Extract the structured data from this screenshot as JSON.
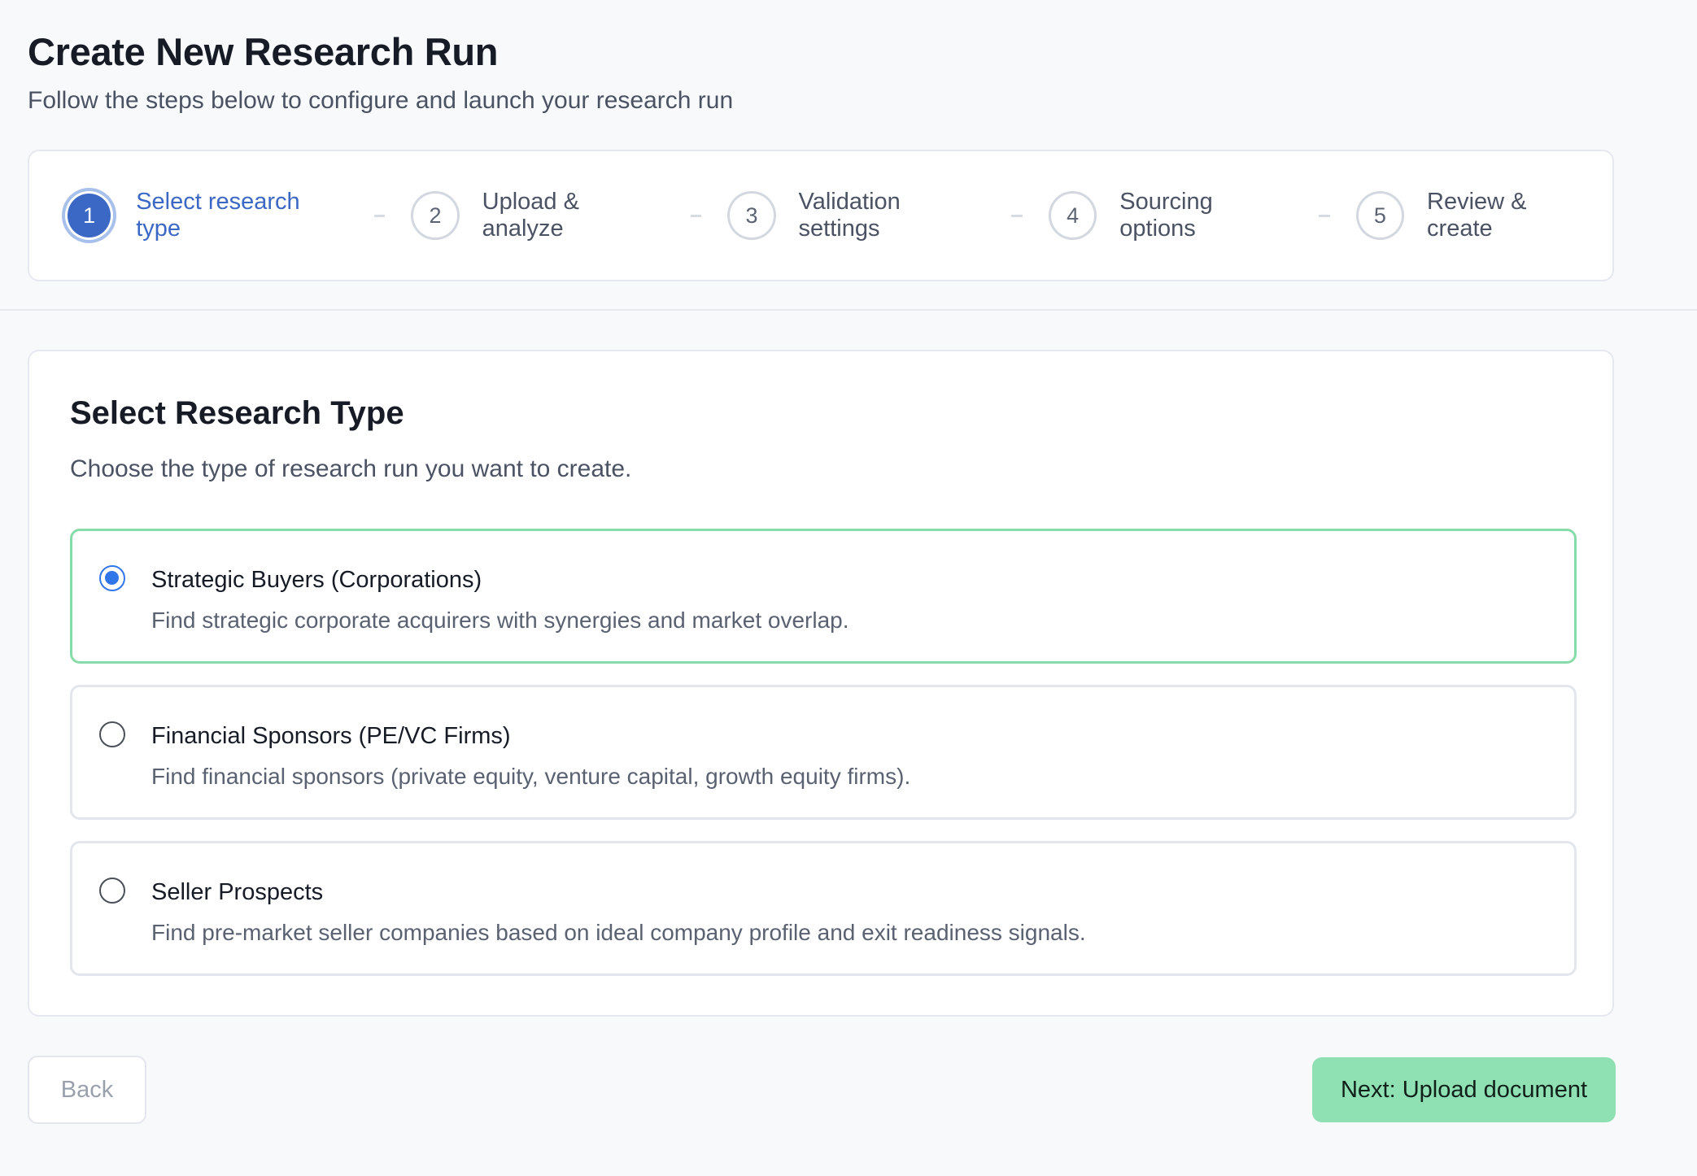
{
  "header": {
    "title": "Create New Research Run",
    "subtitle": "Follow the steps below to configure and launch your research run"
  },
  "stepper": {
    "steps": [
      {
        "number": "1",
        "label": "Select research type",
        "active": true
      },
      {
        "number": "2",
        "label": "Upload & analyze",
        "active": false
      },
      {
        "number": "3",
        "label": "Validation settings",
        "active": false
      },
      {
        "number": "4",
        "label": "Sourcing options",
        "active": false
      },
      {
        "number": "5",
        "label": "Review & create",
        "active": false
      }
    ]
  },
  "card": {
    "title": "Select Research Type",
    "subtitle": "Choose the type of research run you want to create."
  },
  "options": [
    {
      "title": "Strategic Buyers (Corporations)",
      "description": "Find strategic corporate acquirers with synergies and market overlap.",
      "selected": true
    },
    {
      "title": "Financial Sponsors (PE/VC Firms)",
      "description": "Find financial sponsors (private equity, venture capital, growth equity firms).",
      "selected": false
    },
    {
      "title": "Seller Prospects",
      "description": "Find pre-market seller companies based on ideal company profile and exit readiness signals.",
      "selected": false
    }
  ],
  "footer": {
    "back_label": "Back",
    "next_label": "Next: Upload document"
  },
  "colors": {
    "primary": "#3b68c4",
    "selected_border": "#86dca9",
    "next_button": "#8fe0b3",
    "radio_selected": "#3176e8"
  }
}
